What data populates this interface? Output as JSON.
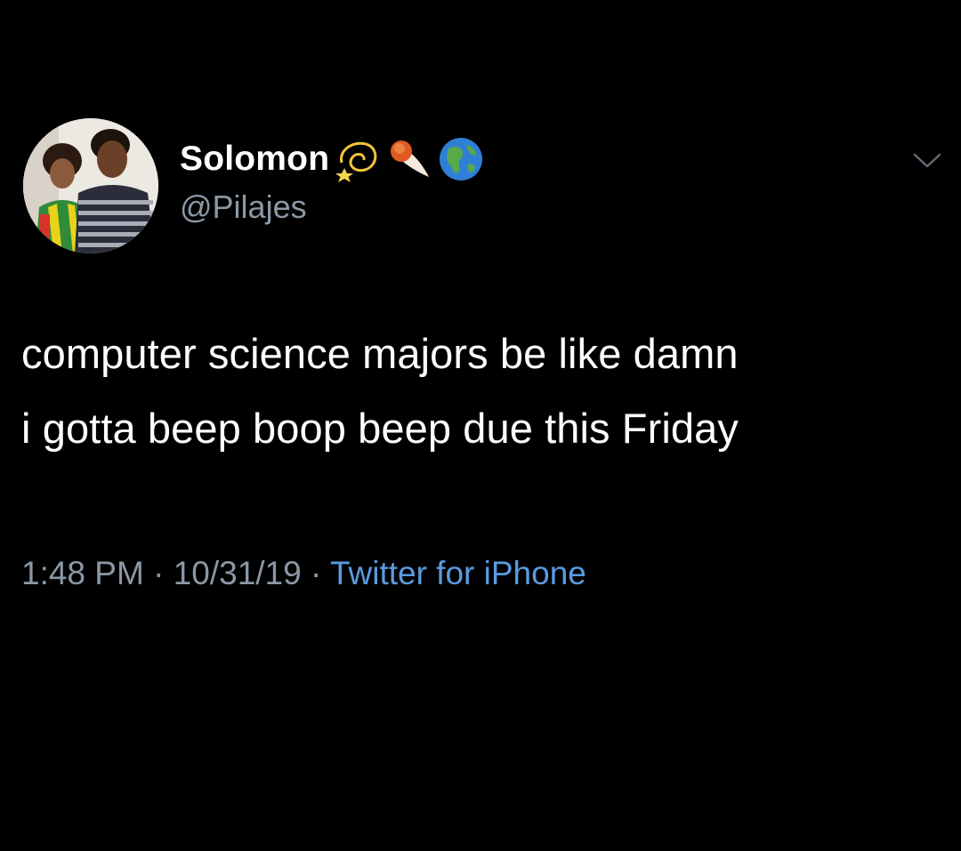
{
  "user": {
    "display_name": "Solomon",
    "handle": "@Pilajes",
    "badges": [
      {
        "icon": "dizzy-star-icon"
      },
      {
        "icon": "comet-icon"
      },
      {
        "icon": "globe-americas-icon"
      }
    ]
  },
  "tweet": {
    "text_line1": "computer science majors be like damn",
    "text_line2": "i gotta beep boop beep due this Friday"
  },
  "meta": {
    "time": "1:48 PM",
    "separator": " · ",
    "date": "10/31/19",
    "source": "Twitter for iPhone"
  },
  "icons": {
    "menu": "chevron-down-icon"
  },
  "colors": {
    "background": "#000000",
    "text": "#ffffff",
    "secondary": "#8b98a5",
    "link": "#5b9be0"
  }
}
